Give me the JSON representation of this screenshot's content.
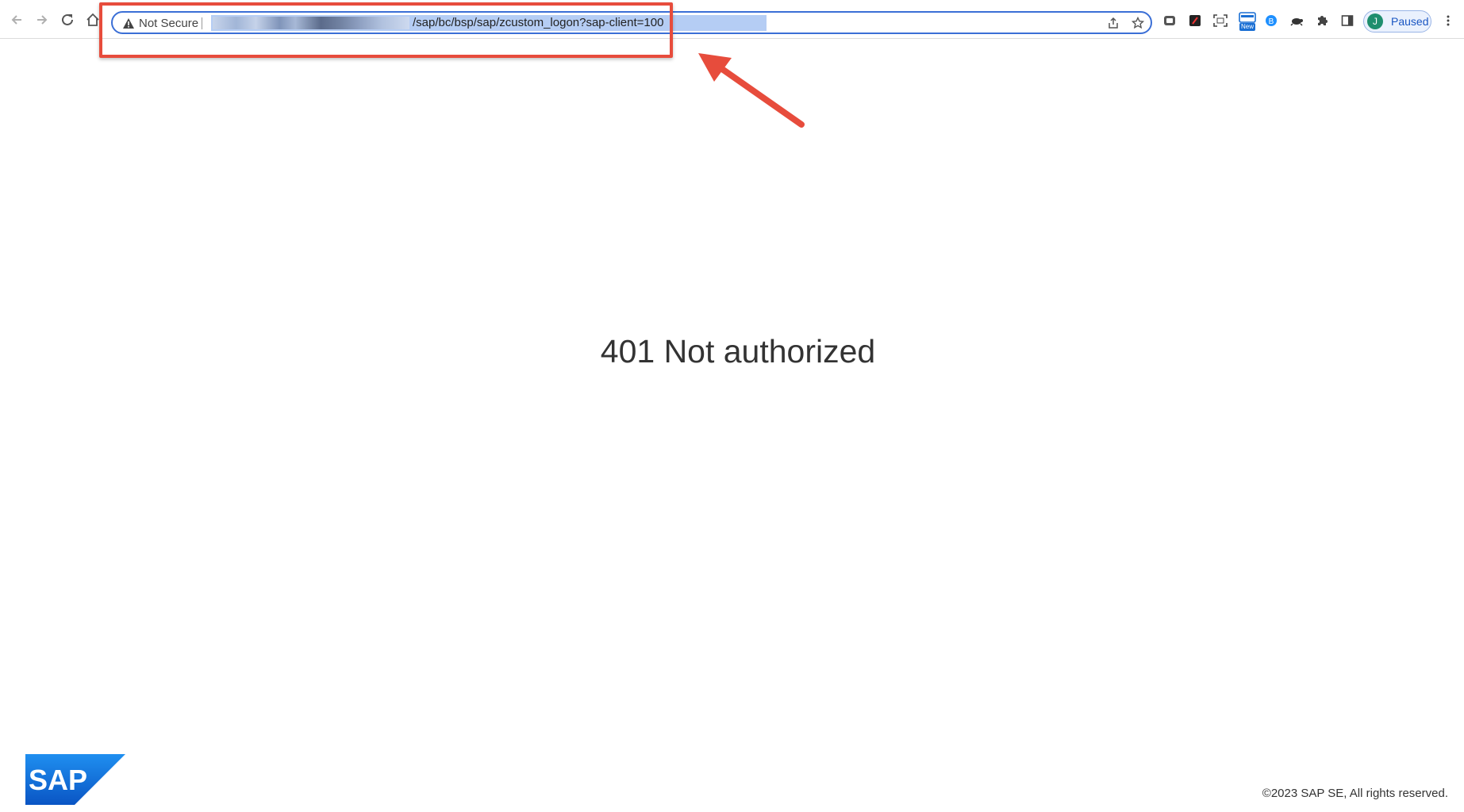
{
  "browser": {
    "security_label": "Not Secure",
    "url_visible_part": "/sap/bc/bsp/sap/zcustom_logon?sap-client=100",
    "profile_initial": "J",
    "profile_status": "Paused",
    "new_badge": "New",
    "icons": [
      "back-arrow-icon",
      "forward-arrow-icon",
      "reload-icon",
      "home-icon",
      "warning-triangle-icon",
      "share-icon",
      "bookmark-star-icon",
      "extension-icons",
      "puzzle-extensions-icon",
      "side-panel-icon",
      "kebab-menu-icon"
    ]
  },
  "page": {
    "message": "401 Not authorized",
    "logo_text": "SAP",
    "copyright": "©2023 SAP SE, All rights reserved."
  },
  "colors": {
    "annotation": "#e74c3c",
    "sap_blue": "#1a6fd4",
    "url_highlight": "#b5cdf4"
  }
}
